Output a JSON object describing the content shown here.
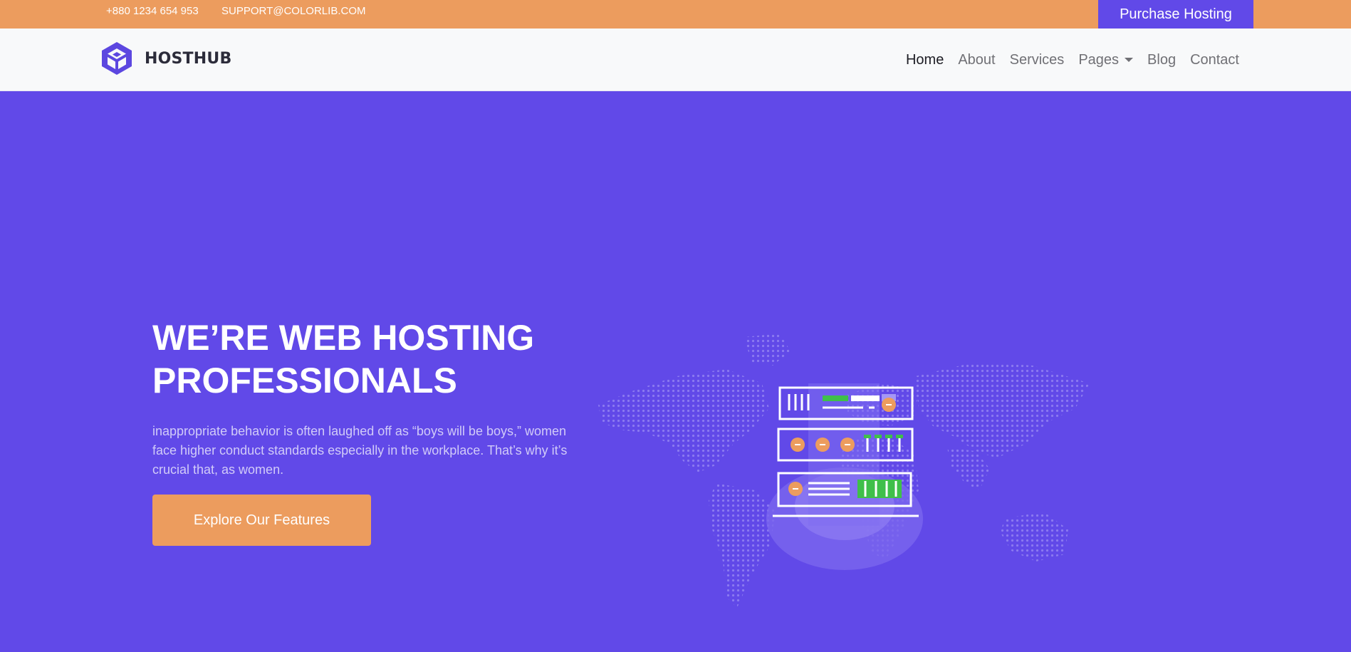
{
  "topbar": {
    "phone": "+880 1234 654 953",
    "email": "SUPPORT@COLORLIB.COM",
    "purchase_label": "Purchase Hosting"
  },
  "brand": {
    "name": "HOSTHUB",
    "icon": "cube-logo-icon"
  },
  "nav": {
    "items": [
      {
        "label": "Home",
        "active": true
      },
      {
        "label": "About"
      },
      {
        "label": "Services"
      },
      {
        "label": "Pages",
        "dropdown": true
      },
      {
        "label": "Blog"
      },
      {
        "label": "Contact"
      }
    ]
  },
  "hero": {
    "title_line1": "WE’RE WEB HOSTING",
    "title_line2": "PROFESSIONALS",
    "description": "inappropriate behavior is often laughed off as “boys will be boys,” women face higher conduct standards especially in the workplace. That’s why it’s crucial that, as women.",
    "cta_label": "Explore Our Features"
  },
  "colors": {
    "accent_orange": "#ec9c5e",
    "brand_purple": "#6149e8",
    "nav_bg": "#f8f9fa"
  }
}
